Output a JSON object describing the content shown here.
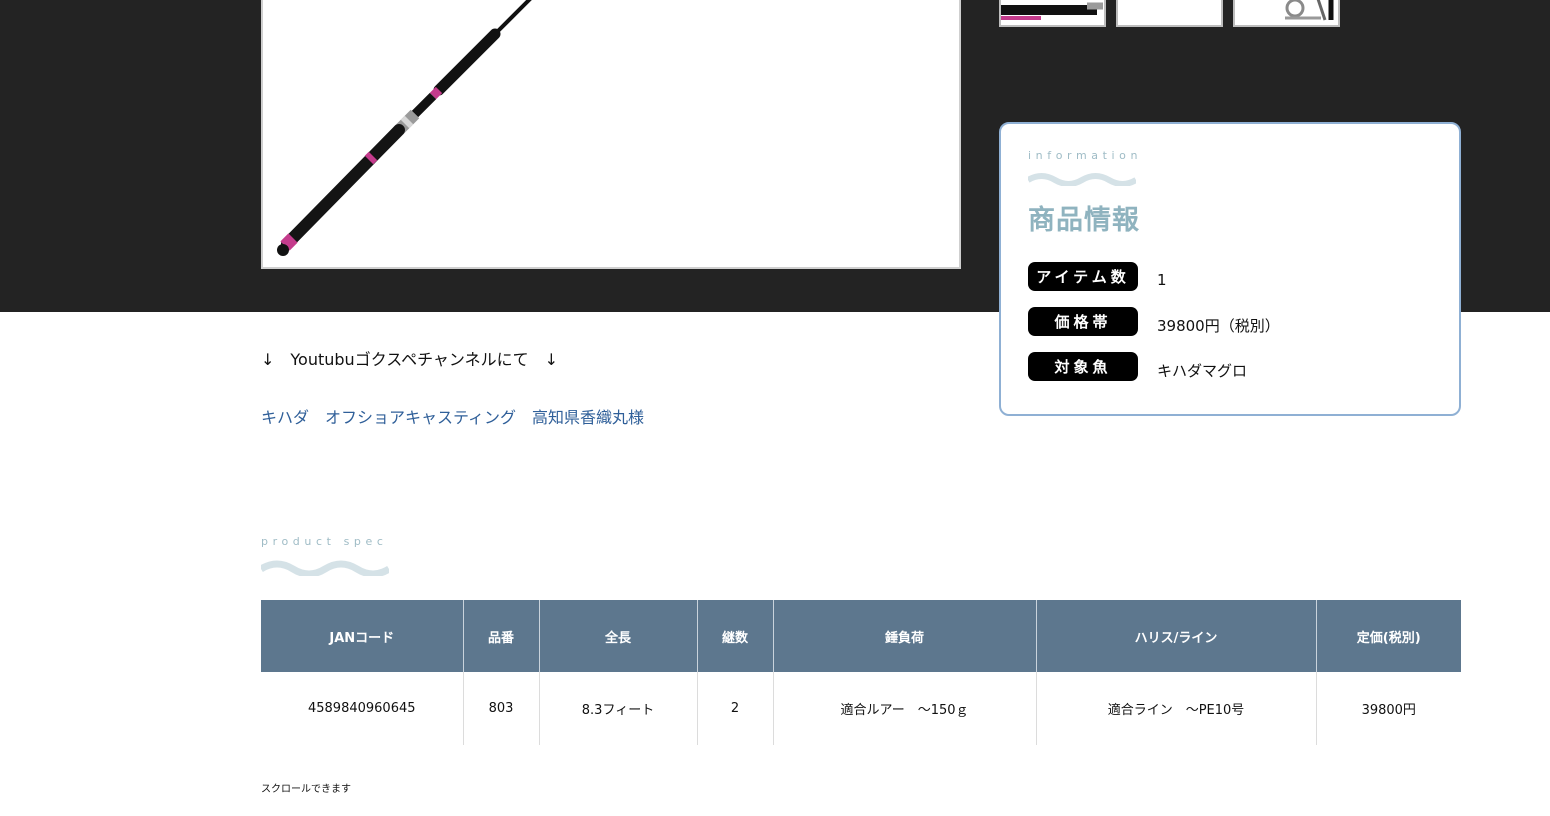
{
  "info": {
    "eyebrow": "information",
    "title": "商品情報",
    "rows": [
      {
        "label": "アイテム数",
        "value": "1"
      },
      {
        "label": "価格帯",
        "value": "39800円（税別）"
      },
      {
        "label": "対象魚",
        "value": "キハダマグロ"
      }
    ]
  },
  "youtube": {
    "heading": "↓　Youtubuゴクスペチャンネルにて　↓",
    "link_text": "キハダ　オフショアキャスティング　高知県香織丸様"
  },
  "spec": {
    "eyebrow": "product spec",
    "headers": [
      "JANコード",
      "品番",
      "全長",
      "継数",
      "錘負荷",
      "ハリス/ライン",
      "定価(税別)"
    ],
    "rows": [
      [
        "4589840960645",
        "803",
        "8.3フィート",
        "2",
        "適合ルアー　～150ｇ",
        "適合ライン　～PE10号",
        "39800円"
      ]
    ],
    "scroll_note": "スクロールできます"
  },
  "colors": {
    "dark_band": "#232323",
    "card_border": "#8fb0d4",
    "accent_light": "#8fb3bf",
    "table_header": "#5d778e",
    "link": "#2f5f99"
  },
  "icons": {
    "wave": "wave-decoration-icon",
    "product": "fishing-rod-image"
  }
}
